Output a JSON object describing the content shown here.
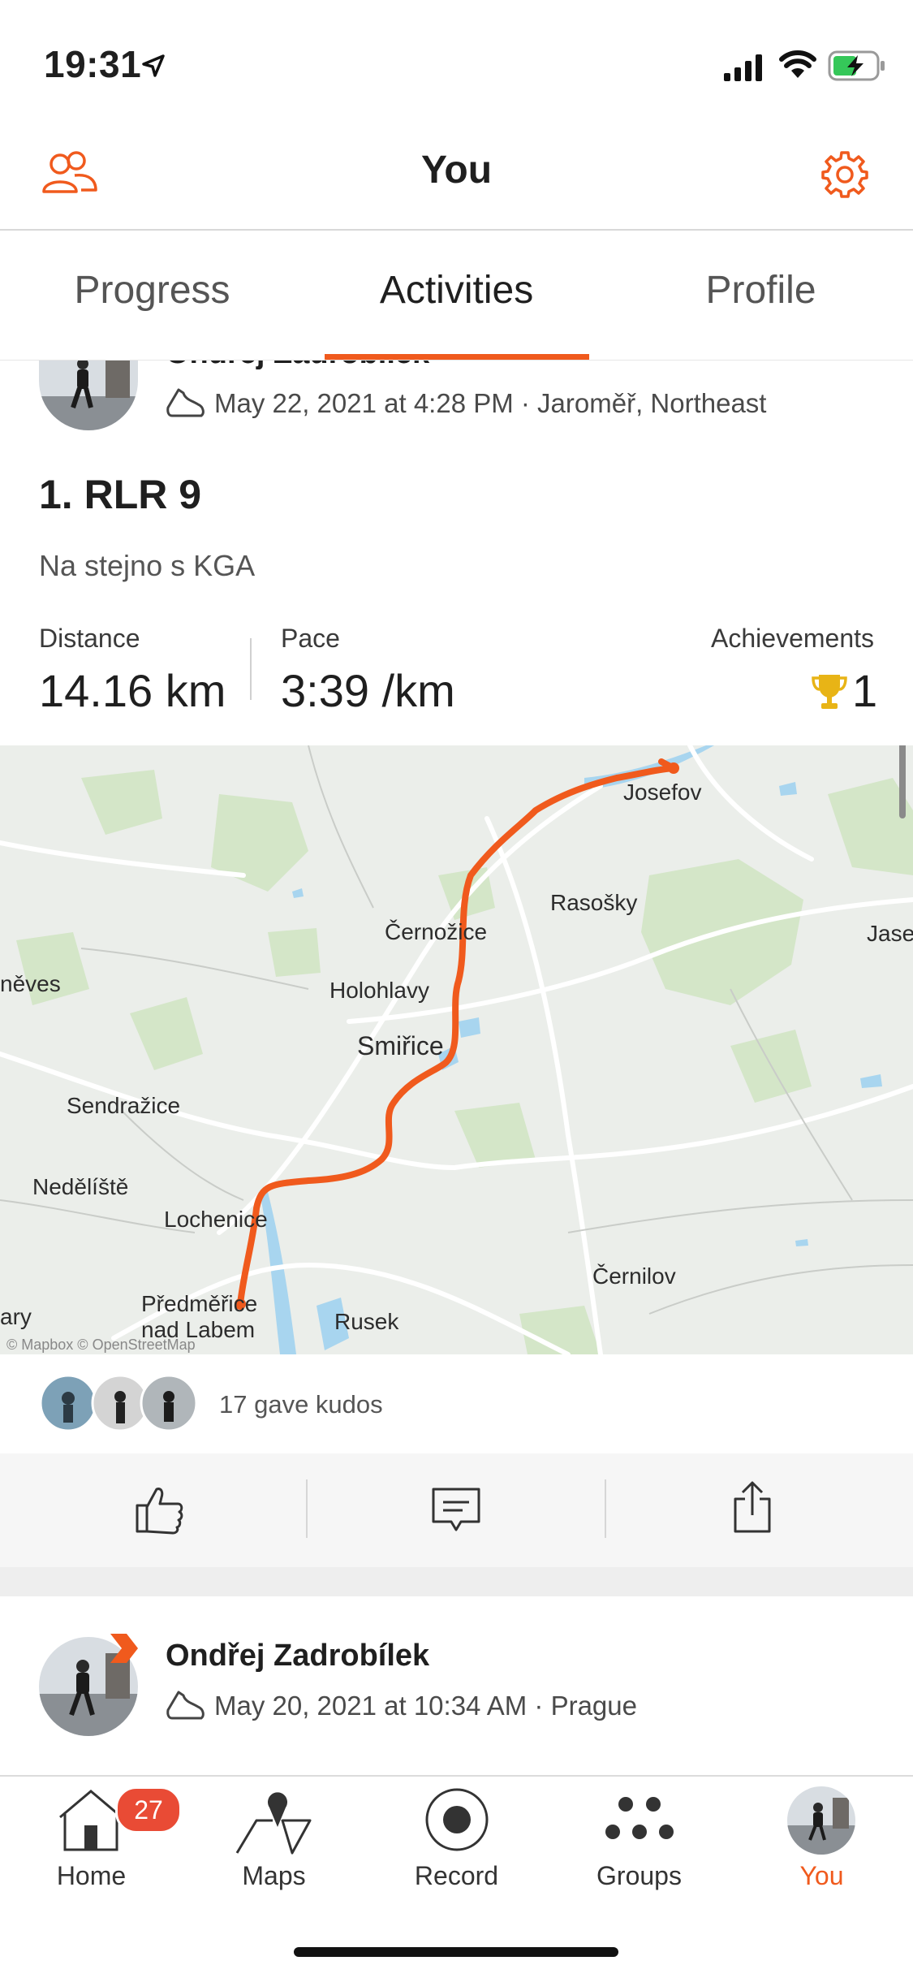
{
  "status_bar": {
    "time": "19:31"
  },
  "header": {
    "title": "You"
  },
  "tabs": [
    {
      "label": "Progress"
    },
    {
      "label": "Activities",
      "active": true
    },
    {
      "label": "Profile"
    }
  ],
  "activity": {
    "athlete_name": "Ondřej Zadrobílek",
    "date_location": "May 22, 2021 at 4:28 PM · Jaroměř, Northeast",
    "title": "1. RLR 9",
    "description": "Na stejno s KGA",
    "stats": {
      "distance_label": "Distance",
      "distance_value": "14.16 km",
      "pace_label": "Pace",
      "pace_value": "3:39 /km",
      "achievements_label": "Achievements",
      "achievements_value": "1"
    },
    "map": {
      "labels": [
        "Josefov",
        "Rasošky",
        "Černožice",
        "Jase",
        "něves",
        "Holohlavy",
        "Smiřice",
        "Sendražice",
        "Nedělíště",
        "Lochenice",
        "Černilov",
        "Předměřice",
        "nad Labem",
        "Rusek",
        "ary"
      ],
      "attribution": "© Mapbox © OpenStreetMap",
      "route_color": "#f05a1d"
    },
    "kudos_text": "17 gave kudos"
  },
  "next_activity": {
    "athlete_name": "Ondřej Zadrobílek",
    "date_location": "May 20, 2021 at 10:34 AM · Prague"
  },
  "tab_bar": {
    "items": [
      {
        "label": "Home",
        "badge": "27"
      },
      {
        "label": "Maps"
      },
      {
        "label": "Record"
      },
      {
        "label": "Groups"
      },
      {
        "label": "You",
        "active": true
      }
    ]
  },
  "colors": {
    "accent": "#f05a1d",
    "trophy": "#e8b416"
  }
}
